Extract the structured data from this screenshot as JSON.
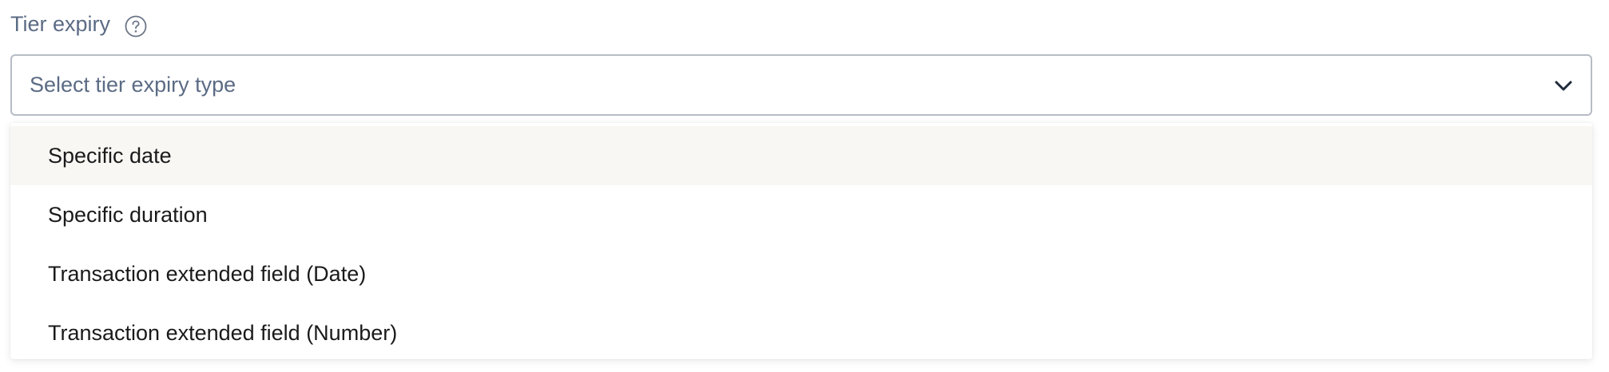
{
  "field": {
    "label": "Tier expiry",
    "help_icon": "question-circle-icon",
    "placeholder": "Select tier expiry type",
    "dropdown_icon": "chevron-down-icon"
  },
  "menu": {
    "items": [
      {
        "label": "Specific date",
        "highlighted": true
      },
      {
        "label": "Specific duration"
      },
      {
        "label": "Transaction extended field (Date)"
      },
      {
        "label": "Transaction extended field (Number)"
      }
    ]
  },
  "colors": {
    "label_text": "#5b6b84",
    "border": "#b6bcc6",
    "highlight_bg": "#f8f7f4",
    "option_text": "#1a1a1a",
    "chevron": "#1e2a3b"
  }
}
